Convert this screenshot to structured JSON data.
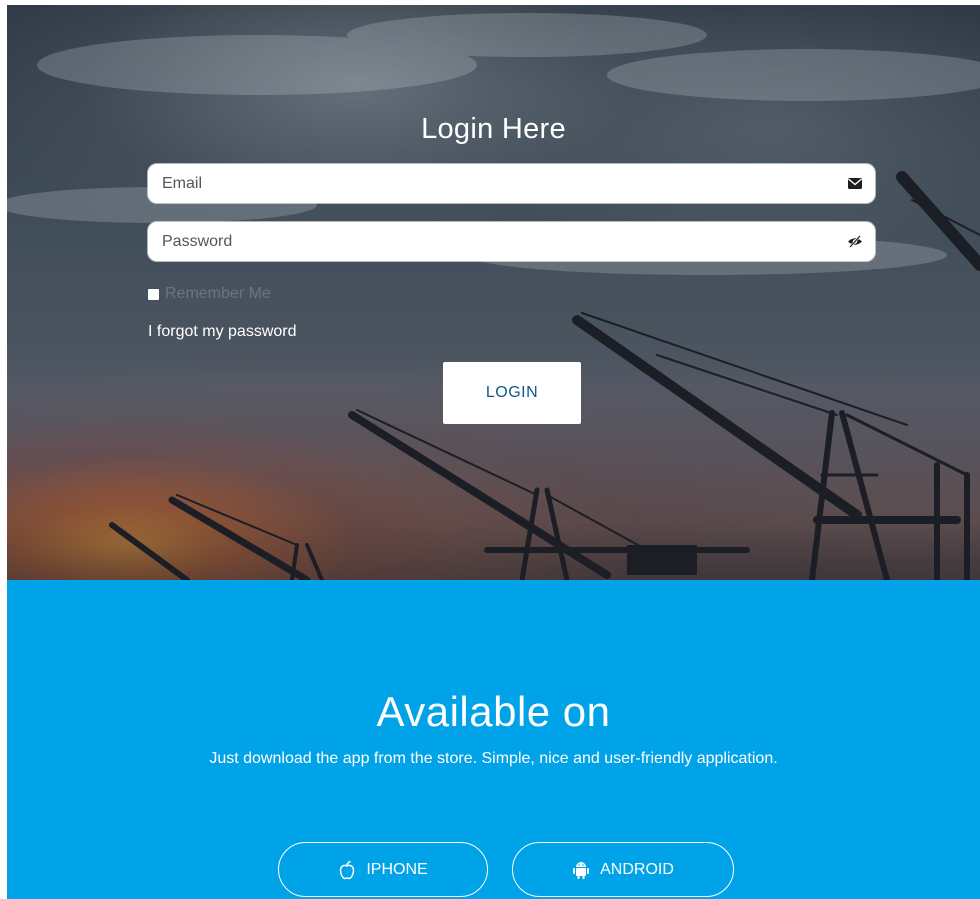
{
  "login": {
    "title": "Login Here",
    "email_placeholder": "Email",
    "password_placeholder": "Password",
    "remember_label": "Remember Me",
    "forgot_link": "I forgot my password",
    "login_button": "LOGIN",
    "icons": {
      "email": "envelope-icon",
      "password": "eye-slash-icon"
    }
  },
  "app_section": {
    "title": "Available on",
    "subtitle": "Just download the app from the store. Simple, nice and user-friendly application.",
    "buttons": [
      {
        "label": "IPHONE",
        "icon": "apple-icon"
      },
      {
        "label": "ANDROID",
        "icon": "android-icon"
      }
    ]
  },
  "colors": {
    "accent_blue": "#00a2e8",
    "login_button_text": "#0d5a8a"
  }
}
